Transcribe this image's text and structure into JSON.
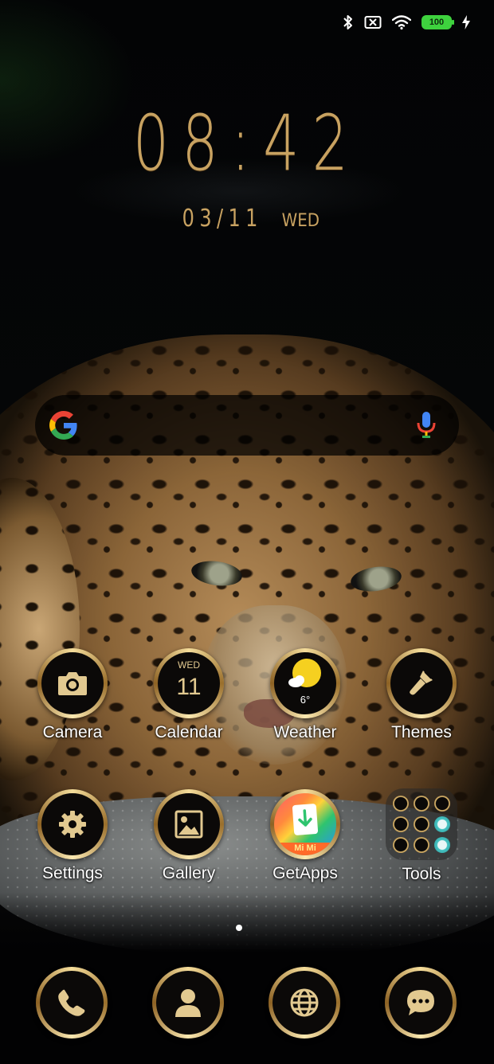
{
  "status_bar": {
    "battery_level": "100",
    "icons": [
      "bluetooth-icon",
      "sim-off-icon",
      "wifi-icon",
      "battery-icon",
      "charging-icon"
    ]
  },
  "clock": {
    "time": "08:42",
    "date": "03/11",
    "weekday": "WED"
  },
  "search": {
    "icons": [
      "google-logo",
      "mic-icon"
    ]
  },
  "apps_row1": [
    {
      "label": "Camera",
      "icon": "camera-icon"
    },
    {
      "label": "Calendar",
      "icon": "calendar-icon",
      "day": "WED",
      "date": "11"
    },
    {
      "label": "Weather",
      "icon": "weather-icon",
      "temp": "6°"
    },
    {
      "label": "Themes",
      "icon": "paintbrush-icon"
    }
  ],
  "apps_row2": [
    {
      "label": "Settings",
      "icon": "gear-icon"
    },
    {
      "label": "Gallery",
      "icon": "image-icon"
    },
    {
      "label": "GetApps",
      "icon": "getapps-icon",
      "badge": "Mi Mi"
    },
    {
      "label": "Tools",
      "icon": "folder-icon"
    }
  ],
  "dock": [
    {
      "name": "phone",
      "icon": "phone-icon"
    },
    {
      "name": "contacts",
      "icon": "contacts-icon"
    },
    {
      "name": "browser",
      "icon": "globe-icon"
    },
    {
      "name": "messages",
      "icon": "messages-icon"
    }
  ],
  "page_indicator": {
    "pages": 1,
    "current": 1
  },
  "colors": {
    "gold": "#c8a261",
    "battery_green": "#3ed23e",
    "ring_dark": "#0b0908"
  }
}
